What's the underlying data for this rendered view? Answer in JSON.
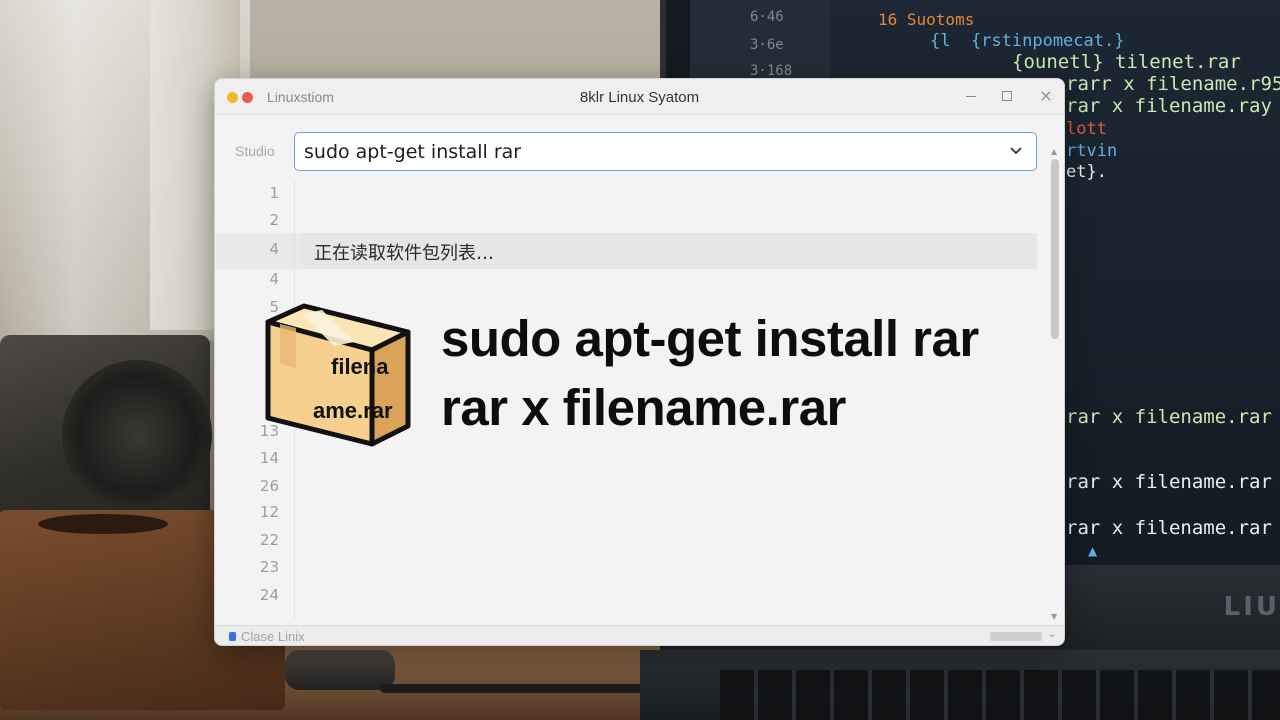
{
  "background": {
    "laptop_brand": "LIU",
    "gutter_numbers": [
      "6·46",
      "3·6e",
      "3·168"
    ],
    "code_lines": [
      {
        "text": "16 Suotoms",
        "tone": "orange"
      },
      {
        "text": "{l  {rstinpomecat.}",
        "tone": "blue"
      },
      {
        "text": "{ounetl} tilenet.rar",
        "tone": "green"
      },
      {
        "text": "rarr x filename.r95",
        "tone": "green"
      },
      {
        "text": "rar x filename.ray",
        "tone": "green"
      },
      {
        "text": "lott",
        "tone": "red"
      },
      {
        "text": "rtvin",
        "tone": "blue"
      },
      {
        "text": "et}.",
        "tone": "white"
      },
      {
        "text": "rar x filename.rar",
        "tone": "green"
      },
      {
        "text": "rar x filename.rar",
        "tone": "white"
      },
      {
        "text": "rar x filename.rar",
        "tone": "white"
      }
    ]
  },
  "window": {
    "app_name": "Linuxstiom",
    "title": "8klr Linux Syatom",
    "minimize_label": "",
    "close_label": "×"
  },
  "toolbar": {
    "label": "Studio",
    "command_value": "sudo apt-get install rar"
  },
  "editor": {
    "line_numbers": [
      "1",
      "2",
      "4",
      "4",
      "5",
      "13",
      "14",
      "26",
      "12",
      "22",
      "23",
      "24"
    ],
    "status_line": "正在读取软件包列表…"
  },
  "statusbar": {
    "text": "Clase Linix"
  },
  "overlay": {
    "box_label_line1": "filena",
    "box_label_line2": "ame.rar",
    "headline_line1": "sudo apt-get install rar",
    "headline_line2": "rar x filename.rar"
  },
  "colors": {
    "accent_border": "#6aa2de",
    "box_fill": "#f6d9a0",
    "box_outline": "#111111"
  }
}
